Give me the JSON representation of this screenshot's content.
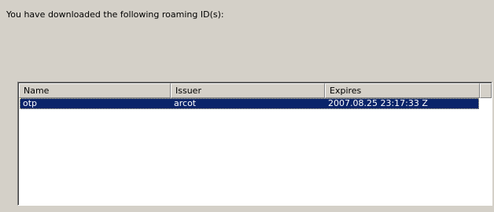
{
  "intro": {
    "text": "You have downloaded the following roaming ID(s):"
  },
  "list": {
    "columns": {
      "name": "Name",
      "issuer": "Issuer",
      "expires": "Expires"
    },
    "rows": [
      {
        "name": "otp",
        "issuer": "arcot",
        "expires": "2007.08.25 23:17:33 Z",
        "selected": true
      }
    ]
  },
  "colors": {
    "dialog_background": "#d4d0c8",
    "selection_background": "#0a246a",
    "selection_text": "#ffffff",
    "list_background": "#ffffff"
  }
}
